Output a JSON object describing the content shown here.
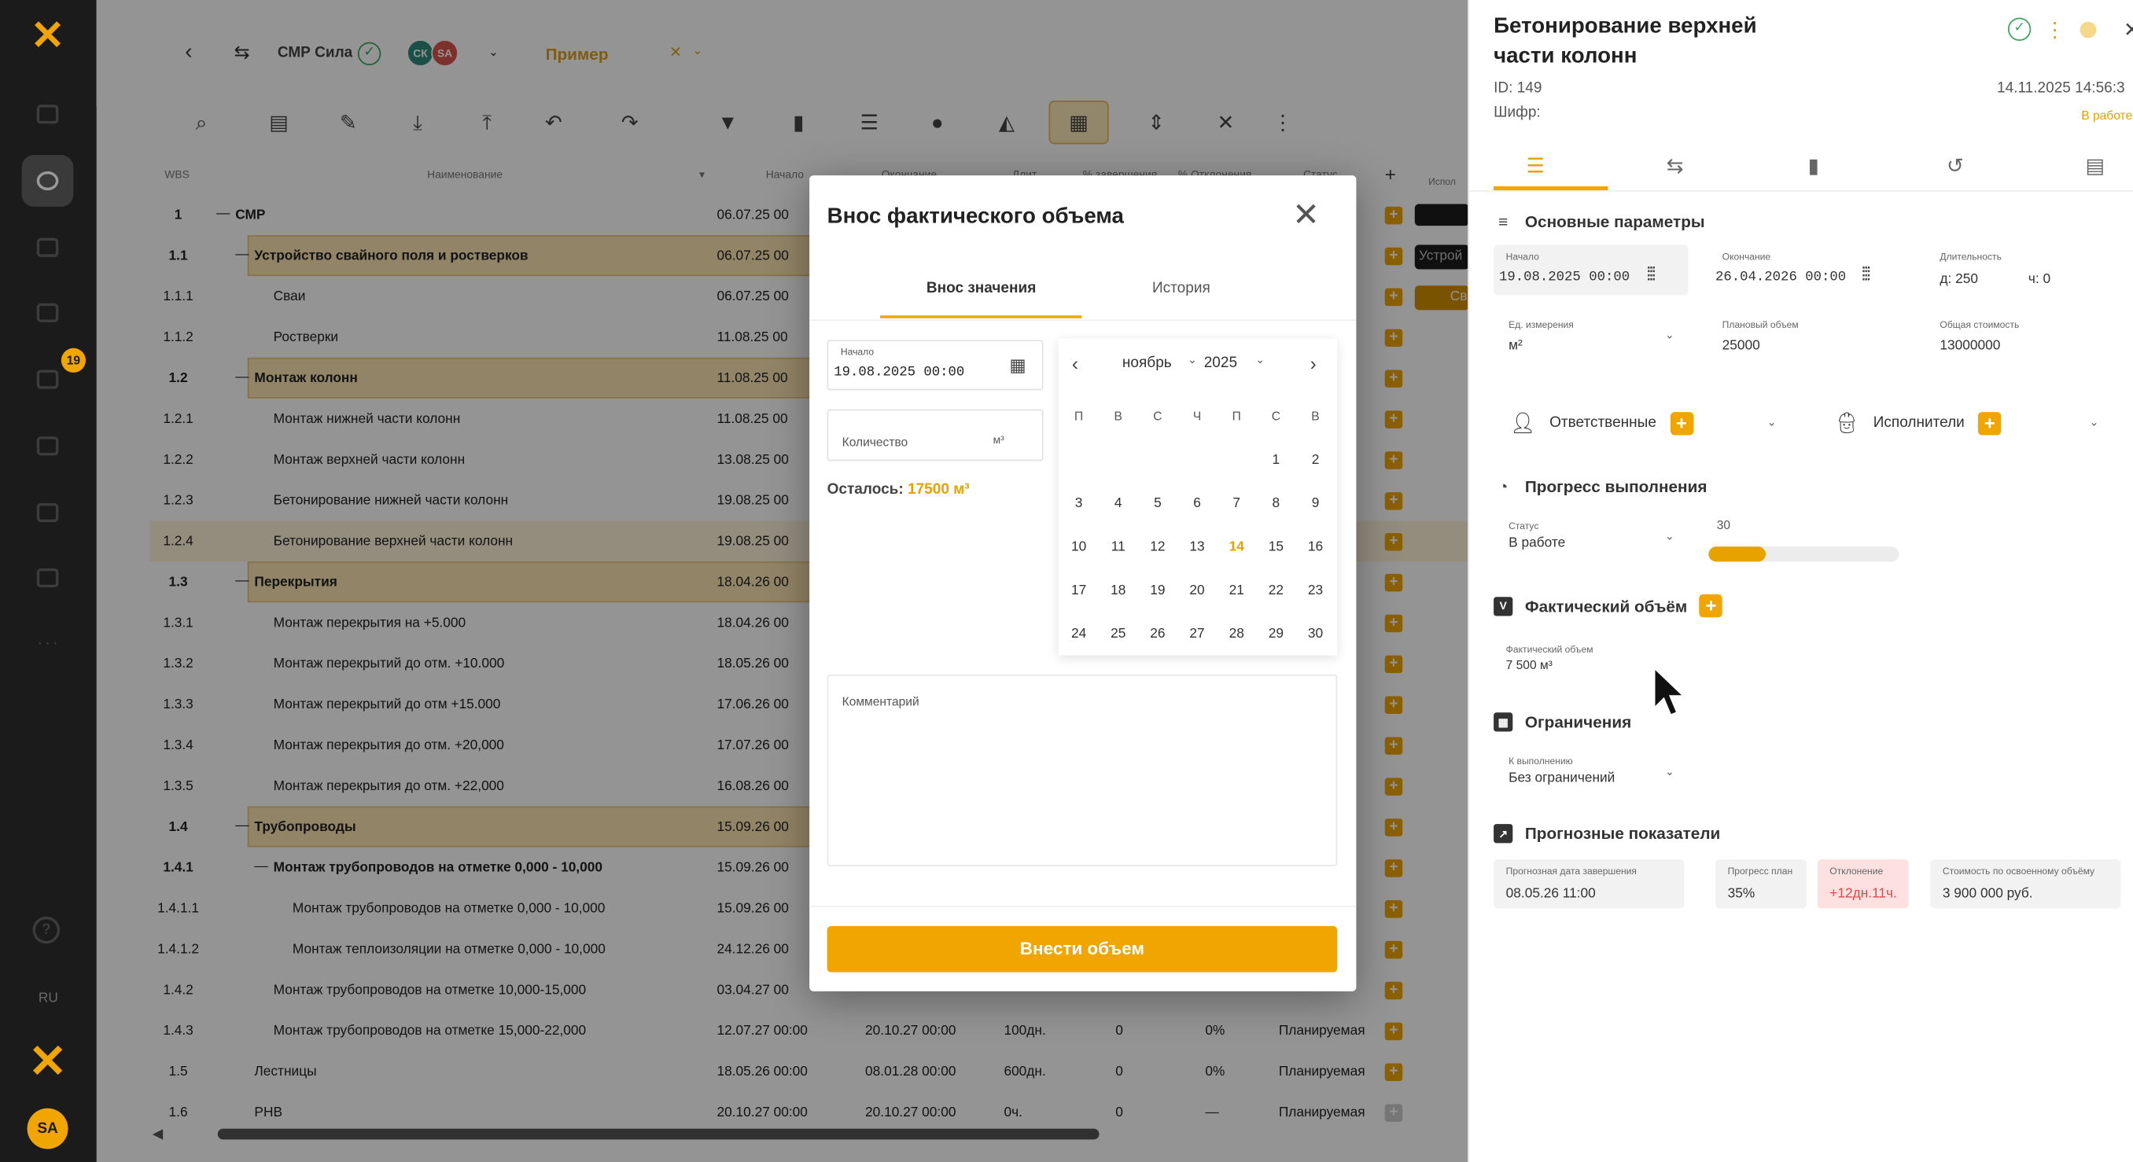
{
  "app": {
    "project": "СМР Сила",
    "example": "Пример",
    "badge_count": "19",
    "lang": "RU",
    "user_initials": "SA",
    "avatars": [
      {
        "initials": "СК",
        "color": "#2e8b7a"
      },
      {
        "initials": "SA",
        "color": "#d9534f"
      }
    ]
  },
  "grid": {
    "headers": [
      "WBS",
      "Наименование",
      "Начало",
      "Окончание",
      "Длит.",
      "% завершения",
      "% Отклонения",
      "Статус",
      "Испол"
    ],
    "rows": [
      {
        "wbs": "1",
        "name": "СМР",
        "start": "06.07.25 00",
        "level": 0,
        "bold": true,
        "collapse": true
      },
      {
        "wbs": "1.1",
        "name": "Устройство свайного поля и ростверков",
        "start": "06.07.25 00",
        "level": 1,
        "bold": true,
        "collapse": true,
        "group": true
      },
      {
        "wbs": "1.1.1",
        "name": "Сваи",
        "start": "06.07.25 00",
        "level": 2
      },
      {
        "wbs": "1.1.2",
        "name": "Ростверки",
        "start": "11.08.25 00",
        "level": 2
      },
      {
        "wbs": "1.2",
        "name": "Монтаж колонн",
        "start": "11.08.25 00",
        "level": 1,
        "bold": true,
        "collapse": true,
        "group": true
      },
      {
        "wbs": "1.2.1",
        "name": "Монтаж нижней части колонн",
        "start": "11.08.25 00",
        "level": 2
      },
      {
        "wbs": "1.2.2",
        "name": "Монтаж верхней части колонн",
        "start": "13.08.25 00",
        "level": 2
      },
      {
        "wbs": "1.2.3",
        "name": "Бетонирование нижней части колонн",
        "start": "19.08.25 00",
        "level": 2
      },
      {
        "wbs": "1.2.4",
        "name": "Бетонирование верхней части колонн",
        "start": "19.08.25 00",
        "level": 2,
        "highlight": true
      },
      {
        "wbs": "1.3",
        "name": "Перекрытия",
        "start": "18.04.26 00",
        "level": 1,
        "bold": true,
        "collapse": true,
        "group": true
      },
      {
        "wbs": "1.3.1",
        "name": "Монтаж перекрытия на +5.000",
        "start": "18.04.26 00",
        "level": 2
      },
      {
        "wbs": "1.3.2",
        "name": "Монтаж перекрытий до отм. +10.000",
        "start": "18.05.26 00",
        "level": 2
      },
      {
        "wbs": "1.3.3",
        "name": "Монтаж перекрытий до отм +15.000",
        "start": "17.06.26 00",
        "level": 2
      },
      {
        "wbs": "1.3.4",
        "name": "Монтаж перекрытия до отм. +20,000",
        "start": "17.07.26 00",
        "level": 2
      },
      {
        "wbs": "1.3.5",
        "name": "Монтаж перекрытия до отм. +22,000",
        "start": "16.08.26 00",
        "level": 2
      },
      {
        "wbs": "1.4",
        "name": "Трубопроводы",
        "start": "15.09.26 00",
        "level": 1,
        "bold": true,
        "collapse": true,
        "group": true
      },
      {
        "wbs": "1.4.1",
        "name": "Монтаж трубопроводов на отметке 0,000 - 10,000",
        "start": "15.09.26 00",
        "level": 2,
        "bold": true,
        "collapse": true
      },
      {
        "wbs": "1.4.1.1",
        "name": "Монтаж трубопроводов на отметке 0,000 - 10,000",
        "start": "15.09.26 00",
        "level": 3
      },
      {
        "wbs": "1.4.1.2",
        "name": "Монтаж теплоизоляции на отметке 0,000 - 10,000",
        "start": "24.12.26 00",
        "level": 3
      },
      {
        "wbs": "1.4.2",
        "name": "Монтаж трубопроводов на отметке 10,000-15,000",
        "start": "03.04.27 00",
        "level": 2
      },
      {
        "wbs": "1.4.3",
        "name": "Монтаж трубопроводов на отметке 15,000-22,000",
        "start": "12.07.27 00:00",
        "end": "20.10.27 00:00",
        "dur": "100дн.",
        "pct": "0",
        "dev": "0%",
        "status": "Планируемая",
        "level": 2
      },
      {
        "wbs": "1.5",
        "name": "Лестницы",
        "start": "18.05.26 00:00",
        "end": "08.01.28 00:00",
        "dur": "600дн.",
        "pct": "0",
        "dev": "0%",
        "status": "Планируемая",
        "level": 1
      },
      {
        "wbs": "1.6",
        "name": "PHB",
        "start": "20.10.27 00:00",
        "end": "20.10.27 00:00",
        "dur": "0ч.",
        "pct": "0",
        "dev": "—",
        "status": "Планируемая",
        "level": 1,
        "plus_disabled": true
      }
    ],
    "peek": [
      "Устрой",
      "Св"
    ]
  },
  "modal": {
    "title": "Внос фактического объема",
    "tabs": [
      "Внос значения",
      "История"
    ],
    "start_label": "Начало",
    "start_value": "19.08.2025 00:00",
    "qty_placeholder": "Количество",
    "qty_unit": "м³",
    "remaining_label": "Осталось:",
    "remaining_value": "17500 м³",
    "comment_placeholder": "Комментарий",
    "submit": "Внести объем",
    "calendar": {
      "month": "ноябрь",
      "year": "2025",
      "weekdays": [
        "П",
        "В",
        "С",
        "Ч",
        "П",
        "С",
        "В"
      ],
      "today": 14
    }
  },
  "panel": {
    "title": "Бетонирование верхней части колонн",
    "id": "ID: 149",
    "cipher": "Шифр:",
    "date": "14.11.2025 14:56:3",
    "status": "В работе",
    "sections": {
      "params": "Основные параметры",
      "progress": "Прогресс выполнения",
      "volume": "Фактический объём",
      "limits": "Ограничения",
      "forecast": "Прогнозные показатели"
    },
    "fields": {
      "start_label": "Начало",
      "start_value": "19.08.2025 00:00",
      "end_label": "Окончание",
      "end_value": "26.04.2026 00:00",
      "duration_label": "Длительность",
      "duration_d": "д: 250",
      "duration_h": "ч: 0",
      "unit_label": "Ед. измерения",
      "unit_value": "м²",
      "planned_label": "Плановый объем",
      "planned_value": "25000",
      "cost_label": "Общая стоимость",
      "cost_value": "13000000"
    },
    "responsible": "Ответственные",
    "executors": "Исполнители",
    "status_label": "Статус",
    "status_value": "В работе",
    "progress_value": "30",
    "progress_fraction": 0.3,
    "volume_label": "Фактический объем",
    "volume_value": "7 500 м³",
    "limit_label": "К выполнению",
    "limit_value": "Без ограничений",
    "forecast": [
      {
        "label": "Прогнозная дата завершения",
        "value": "08.05.26 11:00"
      },
      {
        "label": "Прогресс план",
        "value": "35%"
      },
      {
        "label": "Отклонение",
        "value": "+12дн.11ч."
      },
      {
        "label": "Стоимость по освоенному объёму",
        "value": "3 900 000 руб."
      }
    ]
  }
}
